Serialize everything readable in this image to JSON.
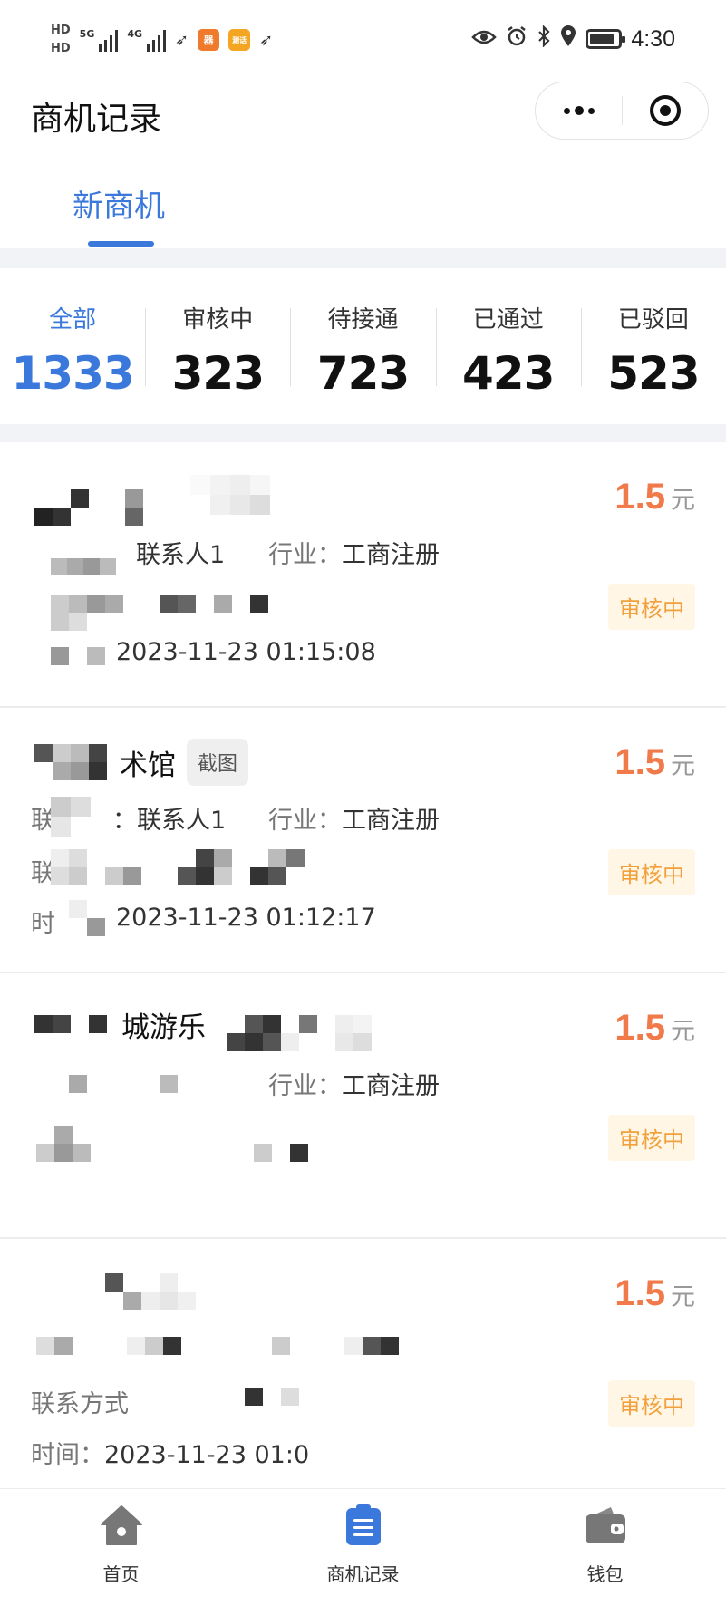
{
  "status_bar": {
    "hd1": "HD",
    "hd2": "HD",
    "net1": "5G",
    "net2": "4G",
    "app1": "器",
    "app2": "涮话",
    "time": "4:30",
    "battery_level": 0.85
  },
  "header": {
    "title": "商机记录"
  },
  "tabs": [
    {
      "label": "新商机",
      "active": true
    }
  ],
  "stats": [
    {
      "label": "全部",
      "value": "1333",
      "active": true
    },
    {
      "label": "审核中",
      "value": "323",
      "active": false
    },
    {
      "label": "待接通",
      "value": "723",
      "active": false
    },
    {
      "label": "已通过",
      "value": "423",
      "active": false
    },
    {
      "label": "已驳回",
      "value": "523",
      "active": false
    }
  ],
  "labels": {
    "industry": "行业：",
    "contact_method": "联系方式",
    "time": "时间："
  },
  "records": [
    {
      "title": "",
      "tag": "",
      "price": "1.5",
      "unit": "元",
      "contact": "联系人1",
      "industry": "工商注册",
      "phone": "",
      "time": "2023-11-23 01:15:08",
      "status": "审核中"
    },
    {
      "title": "术馆",
      "tag": "截图",
      "price": "1.5",
      "unit": "元",
      "contact_label": "联",
      "contact": "联系人1",
      "industry": "工商注册",
      "phone_label": "联",
      "phone": "",
      "time_label": "时",
      "time": "2023-11-23 01:12:17",
      "status": "审核中"
    },
    {
      "title": "城游乐",
      "tag": "",
      "price": "1.5",
      "unit": "元",
      "contact": "",
      "industry": "工商注册",
      "phone": "",
      "time": "",
      "status": "审核中"
    },
    {
      "title": "",
      "tag": "",
      "price": "1.5",
      "unit": "元",
      "contact": "",
      "industry": "",
      "phone": "",
      "time": "2023-11-23 01:0",
      "status": "审核中"
    }
  ],
  "bottom_nav": [
    {
      "label": "首页",
      "icon": "home-icon",
      "active": false
    },
    {
      "label": "商机记录",
      "icon": "list-icon",
      "active": true
    },
    {
      "label": "钱包",
      "icon": "wallet-icon",
      "active": false
    }
  ],
  "colors": {
    "accent": "#3a78dc",
    "price": "#f07a4a",
    "status_text": "#f2a03c",
    "status_bg": "#fff6e6"
  }
}
